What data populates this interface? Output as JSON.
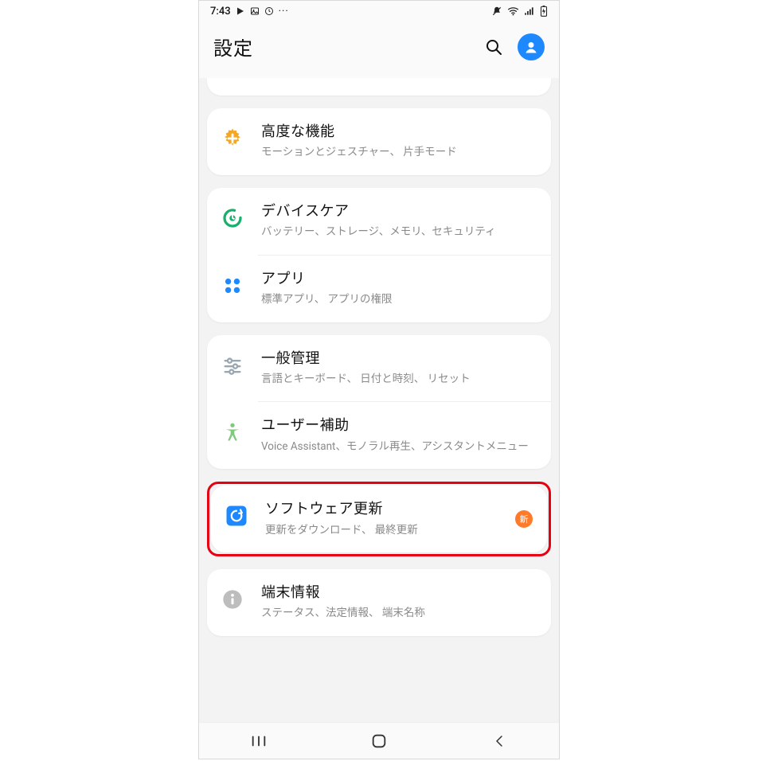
{
  "status": {
    "time": "7:43",
    "left_icons": [
      "play-store-icon",
      "image-icon",
      "clock-icon",
      "more-icon"
    ],
    "right_icons": [
      "mute-icon",
      "wifi-icon",
      "signal-icon",
      "battery-charging-icon"
    ]
  },
  "header": {
    "title": "設定"
  },
  "groups": [
    {
      "partial_top": true,
      "items": []
    },
    {
      "items": [
        {
          "icon": "plus-gear-icon",
          "icon_color": "#f5a623",
          "title": "高度な機能",
          "sub": "モーションとジェスチャー、 片手モード"
        }
      ]
    },
    {
      "items": [
        {
          "icon": "device-care-icon",
          "icon_color": "#17b06b",
          "title": "デバイスケア",
          "sub": "バッテリー、ストレージ、メモリ、セキュリティ"
        },
        {
          "icon": "apps-grid-icon",
          "icon_color": "#1e88ff",
          "title": "アプリ",
          "sub": "標準アプリ、 アプリの権限"
        }
      ]
    },
    {
      "items": [
        {
          "icon": "sliders-icon",
          "icon_color": "#9aa7b0",
          "title": "一般管理",
          "sub": "言語とキーボード、 日付と時刻、 リセット"
        },
        {
          "icon": "accessibility-icon",
          "icon_color": "#7fc97f",
          "title": "ユーザー補助",
          "sub": "Voice Assistant、モノラル再生、アシスタントメニュー"
        }
      ]
    },
    {
      "highlight": true,
      "items": [
        {
          "icon": "update-icon",
          "icon_color": "#1e88ff",
          "title": "ソフトウェア更新",
          "sub": "更新をダウンロード、 最終更新",
          "badge": "新"
        }
      ]
    },
    {
      "items": [
        {
          "icon": "info-icon",
          "icon_color": "#bdbdbd",
          "title": "端末情報",
          "sub": "ステータス、法定情報、 端末名称"
        }
      ]
    }
  ]
}
